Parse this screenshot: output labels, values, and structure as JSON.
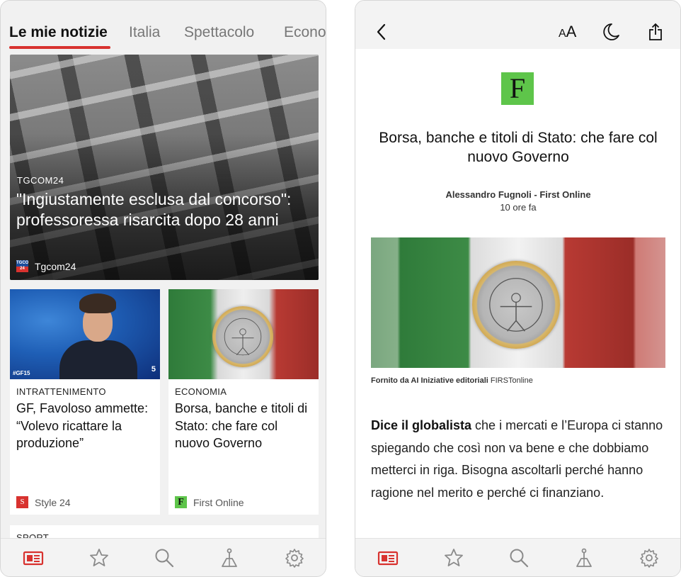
{
  "left": {
    "tabs": [
      {
        "label": "Le mie notizie",
        "active": true
      },
      {
        "label": "Italia",
        "active": false
      },
      {
        "label": "Spettacolo",
        "active": false
      },
      {
        "label": "Econo",
        "active": false
      }
    ],
    "hero": {
      "source": "TGCOM24",
      "title": "\"Ingiustamente esclusa dal concorso\": professoressa risarcita dopo 28 anni",
      "publisher": "Tgcom24",
      "logo_text": "TGCOM 24"
    },
    "cards": [
      {
        "category": "INTRATTENIMENTO",
        "title": "GF, Favoloso ammette: “Volevo ricattare la produzione”",
        "publisher": "Style 24",
        "logo_letter": "S",
        "image_tag": "#GF15",
        "image_channel": "5"
      },
      {
        "category": "ECONOMIA",
        "title": "Borsa, banche e titoli di Stato: che fare col nuovo Governo",
        "publisher": "First Online",
        "logo_letter": "F"
      }
    ],
    "next_card_category": "SPORT"
  },
  "right": {
    "header": {
      "back_icon": "chevron-left-icon",
      "text_size_label": "A",
      "text_size_label_small": "A",
      "night_icon": "moon-icon",
      "share_icon": "share-icon"
    },
    "article": {
      "logo_letter": "F",
      "title": "Borsa, banche e titoli di Stato: che fare col nuovo Governo",
      "author": "Alessandro Fugnoli - First Online",
      "time": "10 ore fa",
      "credit_prefix": "Fornito da AI Iniziative editoriali",
      "credit_brand": "FIRSTonline",
      "body_lead": "Dice il globalista",
      "body_rest": " che i mercati e l’Europa ci stanno spiegando che così non va bene e che dobbiamo metterci in riga. Bisogna ascoltarli perché hanno ragione nel merito e perché ci finanziano."
    }
  },
  "bottom_nav": [
    {
      "name": "news-icon",
      "active": true
    },
    {
      "name": "star-icon",
      "active": false
    },
    {
      "name": "search-icon",
      "active": false
    },
    {
      "name": "local-icon",
      "active": false
    },
    {
      "name": "settings-icon",
      "active": false
    }
  ],
  "colors": {
    "accent": "#d8322f",
    "inactive_icon": "#8a8a8a",
    "firstonline_green": "#5ec54a"
  }
}
